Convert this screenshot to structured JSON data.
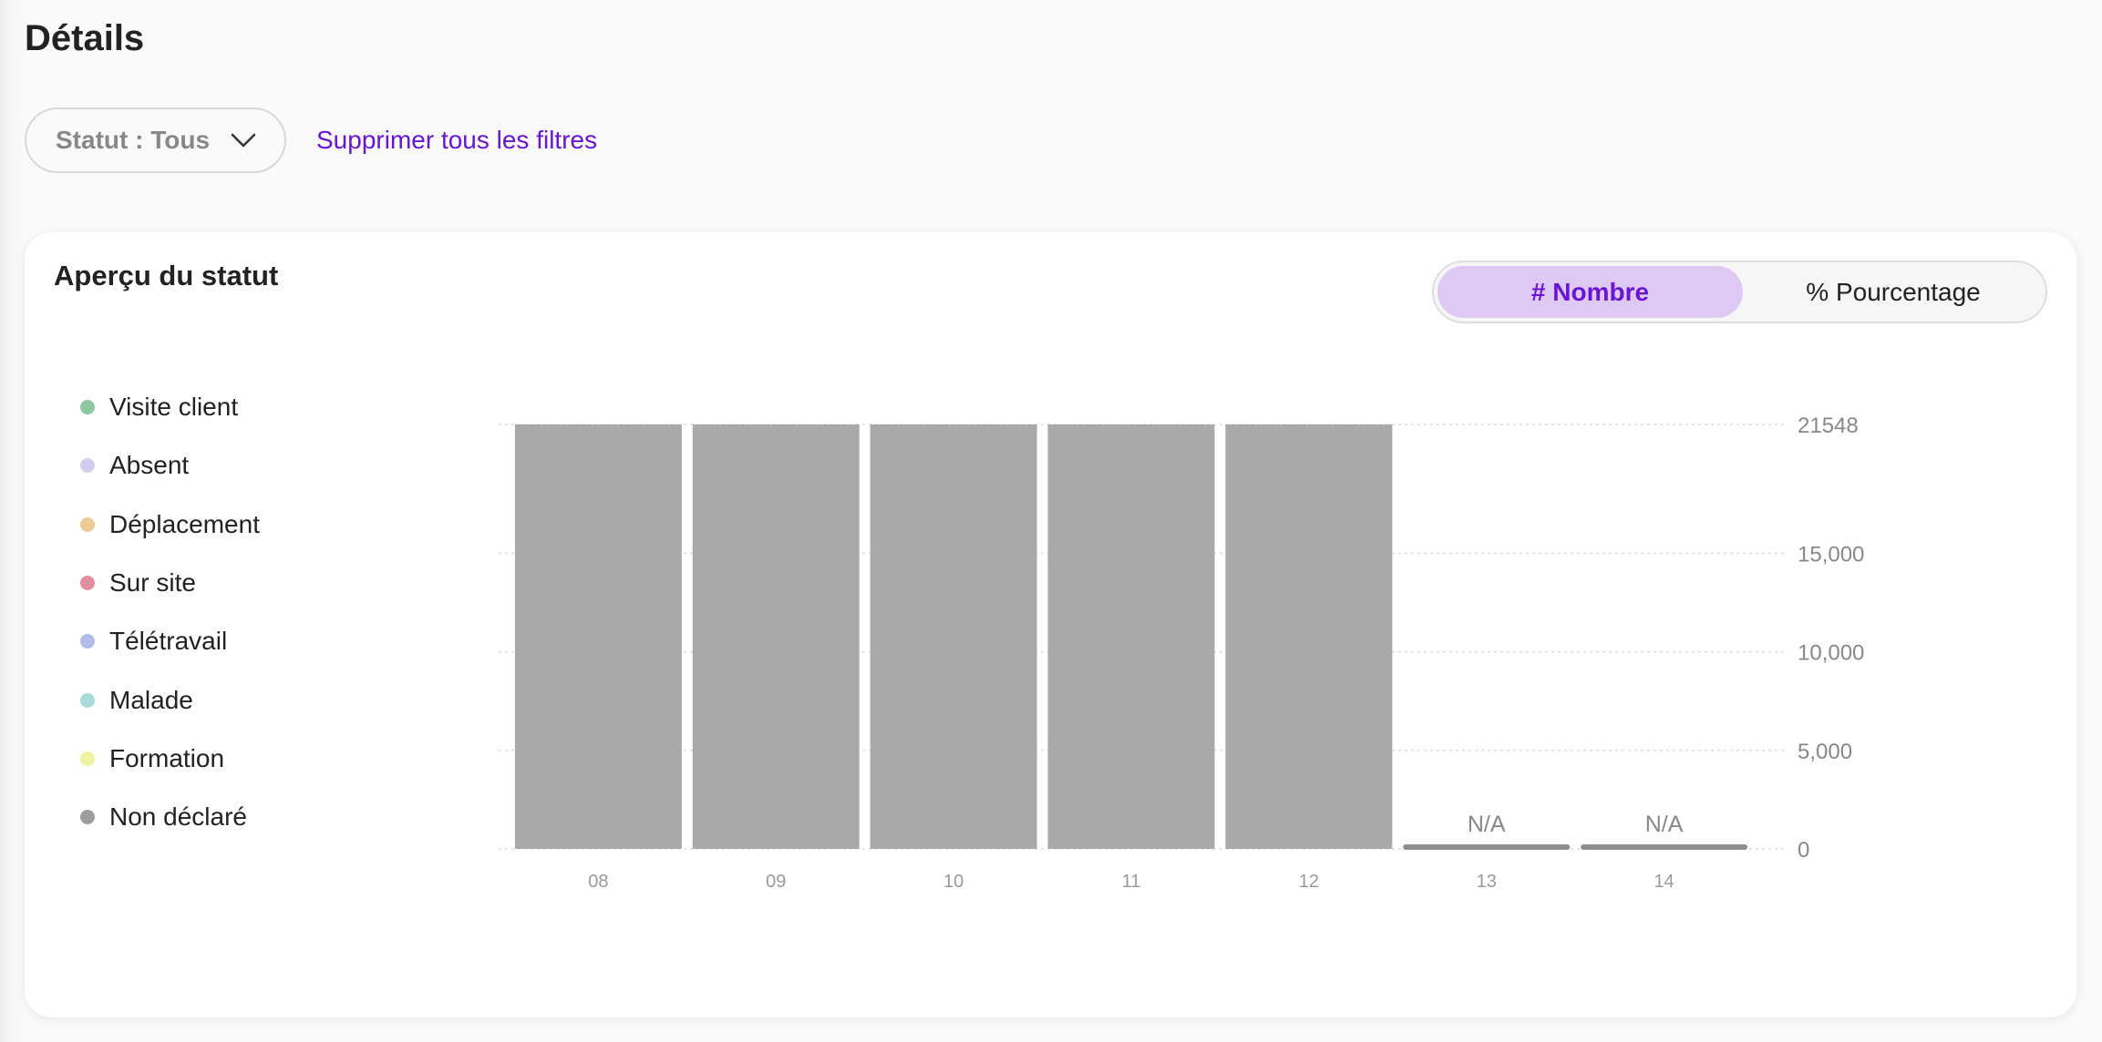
{
  "page": {
    "title": "Détails"
  },
  "filters": {
    "status_label": "Statut : Tous",
    "clear_label": "Supprimer tous les filtres"
  },
  "card": {
    "title": "Aperçu du statut",
    "toggle": {
      "active": "# Nombre",
      "inactive": "% Pourcentage"
    }
  },
  "colors": {
    "accent": "#6a14d4",
    "accent_bg": "#ddc9f4",
    "bar": "#a9a9a9",
    "bar_empty": "#8e8e8e"
  },
  "legend": [
    {
      "label": "Visite client",
      "color": "#8fc8a0"
    },
    {
      "label": "Absent",
      "color": "#d4ccf0"
    },
    {
      "label": "Déplacement",
      "color": "#f0c898"
    },
    {
      "label": "Sur site",
      "color": "#e08fa0"
    },
    {
      "label": "Télétravail",
      "color": "#b4bcec"
    },
    {
      "label": "Malade",
      "color": "#a8dcd8"
    },
    {
      "label": "Formation",
      "color": "#eef4a0"
    },
    {
      "label": "Non déclaré",
      "color": "#9e9e9e"
    }
  ],
  "chart_data": {
    "type": "bar",
    "categories": [
      "08",
      "09",
      "10",
      "11",
      "12",
      "13",
      "14"
    ],
    "values": [
      21548,
      21548,
      21548,
      21548,
      21548,
      null,
      null
    ],
    "value_labels": [
      "",
      "",
      "",
      "",
      "",
      "N/A",
      "N/A"
    ],
    "yticks": [
      0,
      5000,
      10000,
      15000,
      21548
    ],
    "ytick_labels": [
      "0",
      "5,000",
      "10,000",
      "15,000",
      "21548"
    ],
    "ylim": [
      0,
      21548
    ],
    "grid": true,
    "y_axis_side": "right",
    "title": "",
    "xlabel": "",
    "ylabel": ""
  }
}
